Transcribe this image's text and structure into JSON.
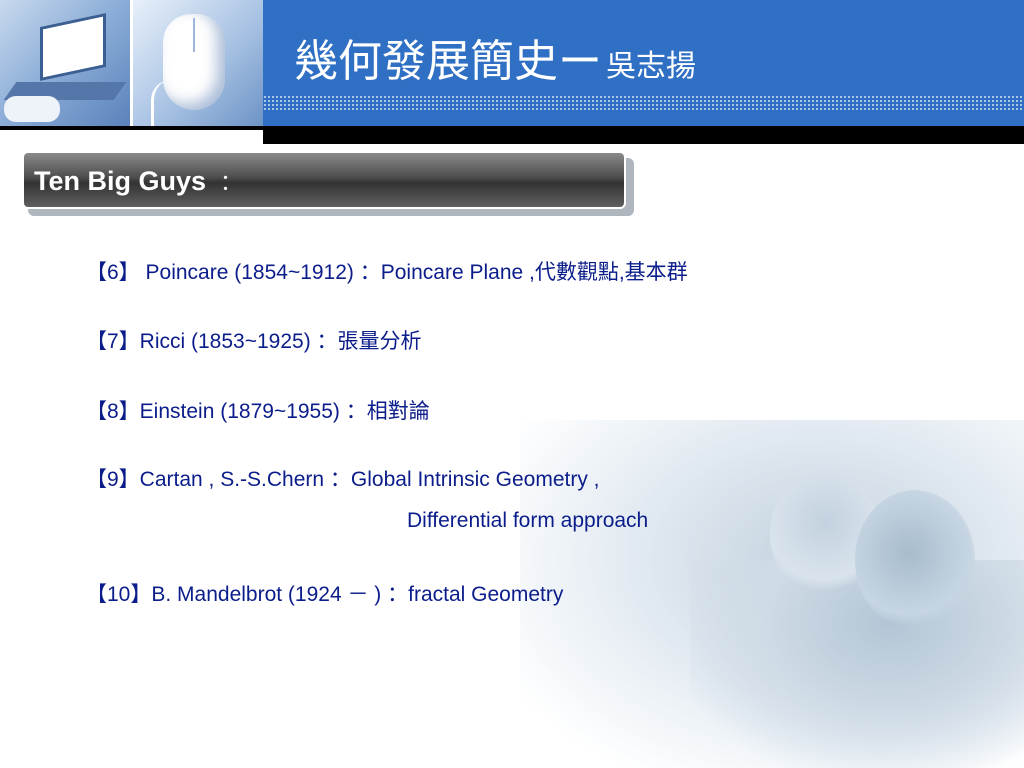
{
  "header": {
    "title": "幾何發展簡史ー",
    "author": "吳志揚"
  },
  "section": {
    "label": "Ten Big Guys",
    "colon": "："
  },
  "items": [
    {
      "text": "【6】 Poincare (1854~1912) ：Poincare Plane ,代數觀點,基本群"
    },
    {
      "text": "【7】Ricci (1853~1925) ：張量分析"
    },
    {
      "text": "【8】Einstein (1879~1955) ：相對論"
    },
    {
      "text": "【9】Cartan , S.-S.Chern ：Global Intrinsic Geometry ,"
    },
    {
      "text": "Differential form approach"
    },
    {
      "text": "【10】B. Mandelbrot  (1924 － ) ：fractal Geometry"
    }
  ],
  "colors": {
    "header_blue": "#2f6fc4",
    "text_navy": "#0b1d8a"
  }
}
